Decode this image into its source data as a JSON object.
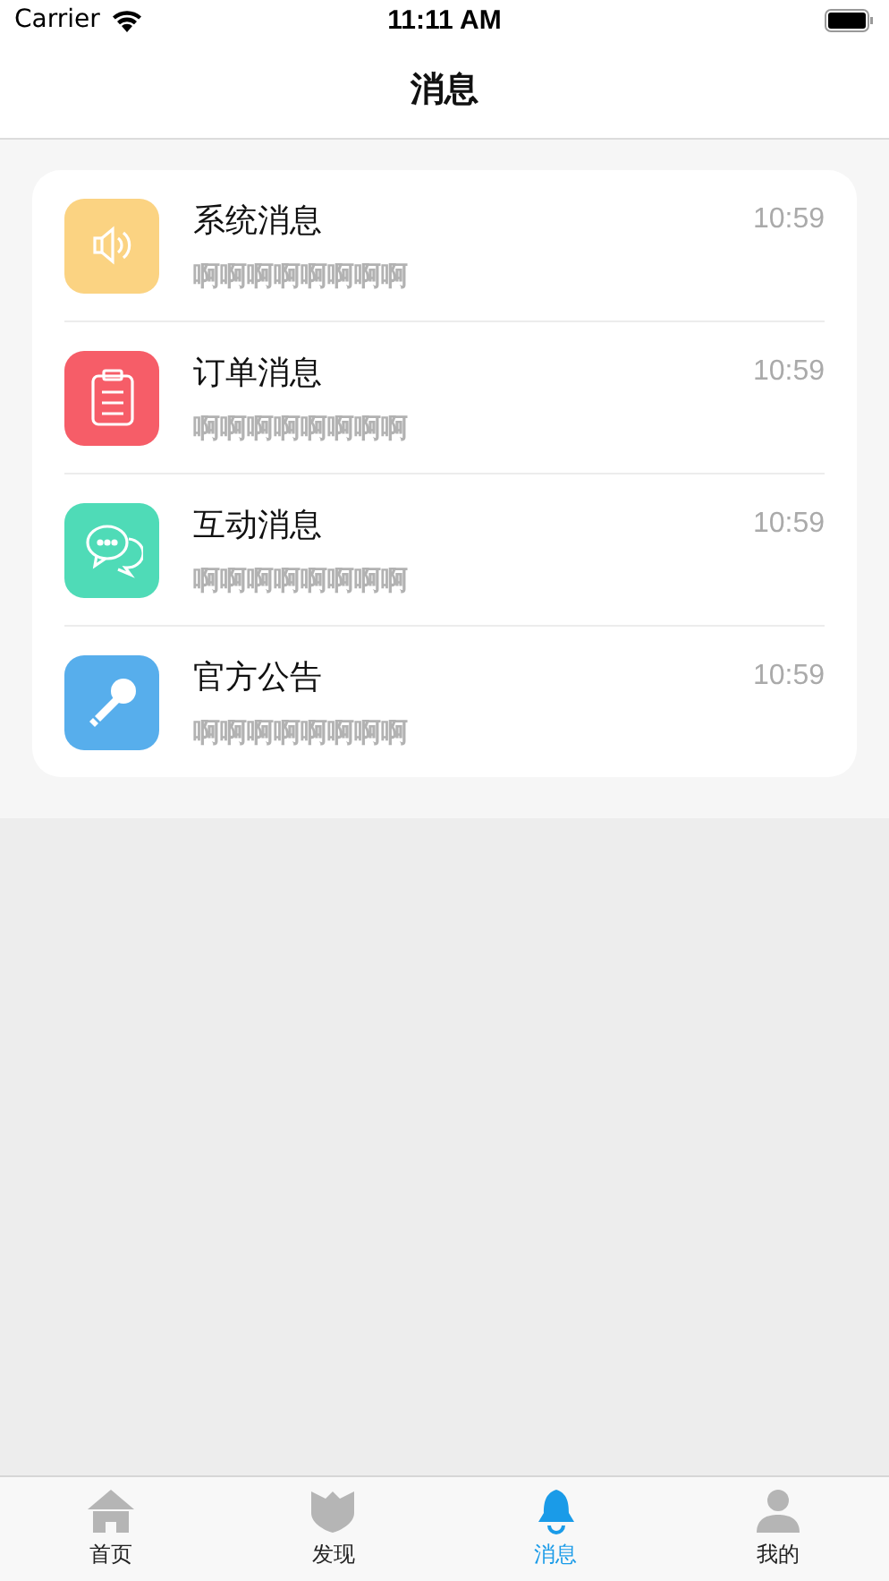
{
  "status_bar": {
    "carrier": "Carrier",
    "time": "11:11 AM"
  },
  "nav": {
    "title": "消息"
  },
  "messages": [
    {
      "kind": "speaker",
      "color": "#fbd382",
      "title": "系统消息",
      "preview": "啊啊啊啊啊啊啊啊",
      "time": "10:59"
    },
    {
      "kind": "clipboard",
      "color": "#f65d68",
      "title": "订单消息",
      "preview": "啊啊啊啊啊啊啊啊",
      "time": "10:59"
    },
    {
      "kind": "chat",
      "color": "#4fdbb7",
      "title": "互动消息",
      "preview": "啊啊啊啊啊啊啊啊",
      "time": "10:59"
    },
    {
      "kind": "mic",
      "color": "#57aeec",
      "title": "官方公告",
      "preview": "啊啊啊啊啊啊啊啊",
      "time": "10:59"
    }
  ],
  "tabs": [
    {
      "kind": "home",
      "label": "首页",
      "selected": false
    },
    {
      "kind": "discover",
      "label": "发现",
      "selected": false
    },
    {
      "kind": "bell",
      "label": "消息",
      "selected": true
    },
    {
      "kind": "person",
      "label": "我的",
      "selected": false
    }
  ]
}
